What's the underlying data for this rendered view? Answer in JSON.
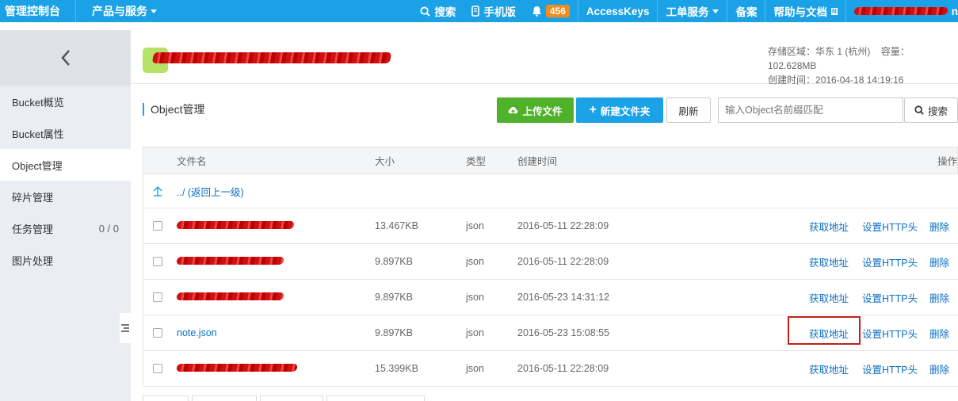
{
  "topbar": {
    "brand": "管理控制台",
    "products": "产品与服务",
    "search": "搜索",
    "mobile": "手机版",
    "notifications_count": "456",
    "accesskeys": "AccessKeys",
    "tickets": "工单服务",
    "beian": "备案",
    "help": "帮助与文档",
    "new_badge": "N",
    "user_suffix": "n"
  },
  "sidebar": {
    "items": [
      {
        "label": "Bucket概览"
      },
      {
        "label": "Bucket属性"
      },
      {
        "label": "Object管理"
      },
      {
        "label": "碎片管理"
      },
      {
        "label": "任务管理",
        "count": "0 / 0"
      },
      {
        "label": "图片处理"
      }
    ]
  },
  "project": {
    "region_label": "存储区域：",
    "region": "华东 1 (杭州)",
    "capacity_label": "容量：",
    "capacity": "102.628MB",
    "created_label": "创建时间：",
    "created": "2016-04-18 14:19:16"
  },
  "section": {
    "title": "Object管理"
  },
  "toolbar": {
    "upload": "上传文件",
    "new_folder": "新建文件夹",
    "refresh": "刷新",
    "search_placeholder": "输入Object名前缀匹配",
    "search": "搜索"
  },
  "table": {
    "headers": {
      "name": "文件名",
      "size": "大小",
      "type": "类型",
      "created": "创建时间",
      "actions": "操作"
    },
    "parent_link": "../ (返回上一级)",
    "actions": {
      "get_url": "获取地址",
      "set_http": "设置HTTP头",
      "delete": "删除"
    },
    "rows": [
      {
        "name": "",
        "size": "13.467KB",
        "type": "json",
        "time": "2016-05-11 22:28:09"
      },
      {
        "name": "",
        "size": "9.897KB",
        "type": "json",
        "time": "2016-05-11 22:28:09"
      },
      {
        "name": "",
        "size": "9.897KB",
        "type": "json",
        "time": "2016-05-23 14:31:12"
      },
      {
        "name": "note.json",
        "size": "9.897KB",
        "type": "json",
        "time": "2016-05-23 15:08:55"
      },
      {
        "name": "",
        "size": "15.399KB",
        "type": "json",
        "time": "2016-05-11 22:28:09"
      }
    ]
  },
  "colors": {
    "topbar": "#1aa1e6",
    "upload_button": "#4fb22a",
    "new_folder_button": "#1aa1e6",
    "link": "#0e6fc5",
    "highlight": "#c0211b"
  }
}
